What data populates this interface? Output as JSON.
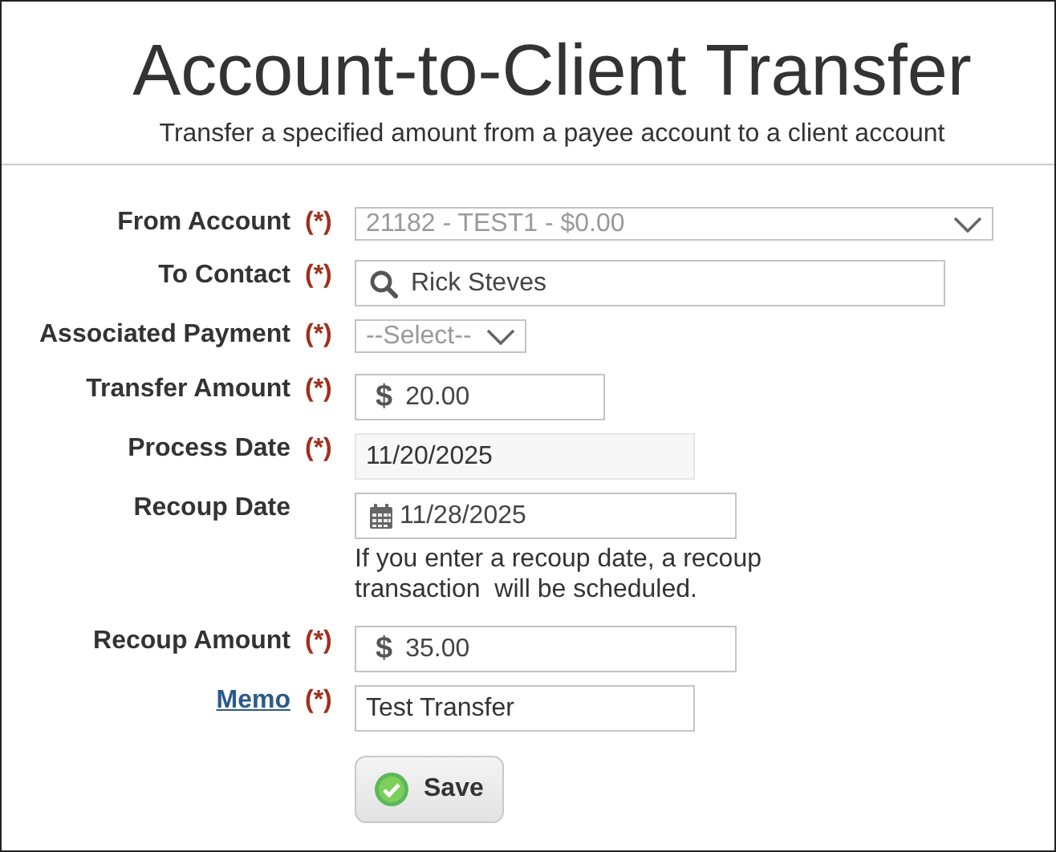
{
  "header": {
    "title": "Account-to-Client Transfer",
    "subtitle": "Transfer a specified amount from a payee account to a client account"
  },
  "fields": [
    {
      "label": "From Account",
      "link": false,
      "required": true,
      "kind": "select",
      "value": "21182 - TEST1 - $0.00",
      "disabled": true
    },
    {
      "label": "To Contact",
      "link": false,
      "required": true,
      "kind": "search",
      "value": "Rick Steves",
      "disabled": false
    },
    {
      "label": "Associated Payment",
      "link": false,
      "required": true,
      "kind": "select",
      "value": "--Select--",
      "disabled": true
    },
    {
      "label": "Transfer Amount",
      "link": false,
      "required": true,
      "kind": "currency",
      "prefix": "$",
      "value": "20.00",
      "disabled": false
    },
    {
      "label": "Process Date",
      "link": false,
      "required": true,
      "kind": "readonly",
      "value": "11/20/2025",
      "disabled": false
    },
    {
      "label": "Recoup Date",
      "link": false,
      "required": false,
      "kind": "date",
      "value": "11/28/2025",
      "disabled": false,
      "help": "If you enter a recoup date, a recoup transaction  will be scheduled."
    },
    {
      "label": "Recoup Amount",
      "link": false,
      "required": true,
      "kind": "currency",
      "prefix": "$",
      "value": "35.00",
      "disabled": false
    },
    {
      "label": "Memo",
      "link": true,
      "required": true,
      "kind": "text",
      "value": "Test Transfer",
      "disabled": false
    }
  ],
  "required_mark": "(*)",
  "save_button": {
    "label": "Save"
  }
}
